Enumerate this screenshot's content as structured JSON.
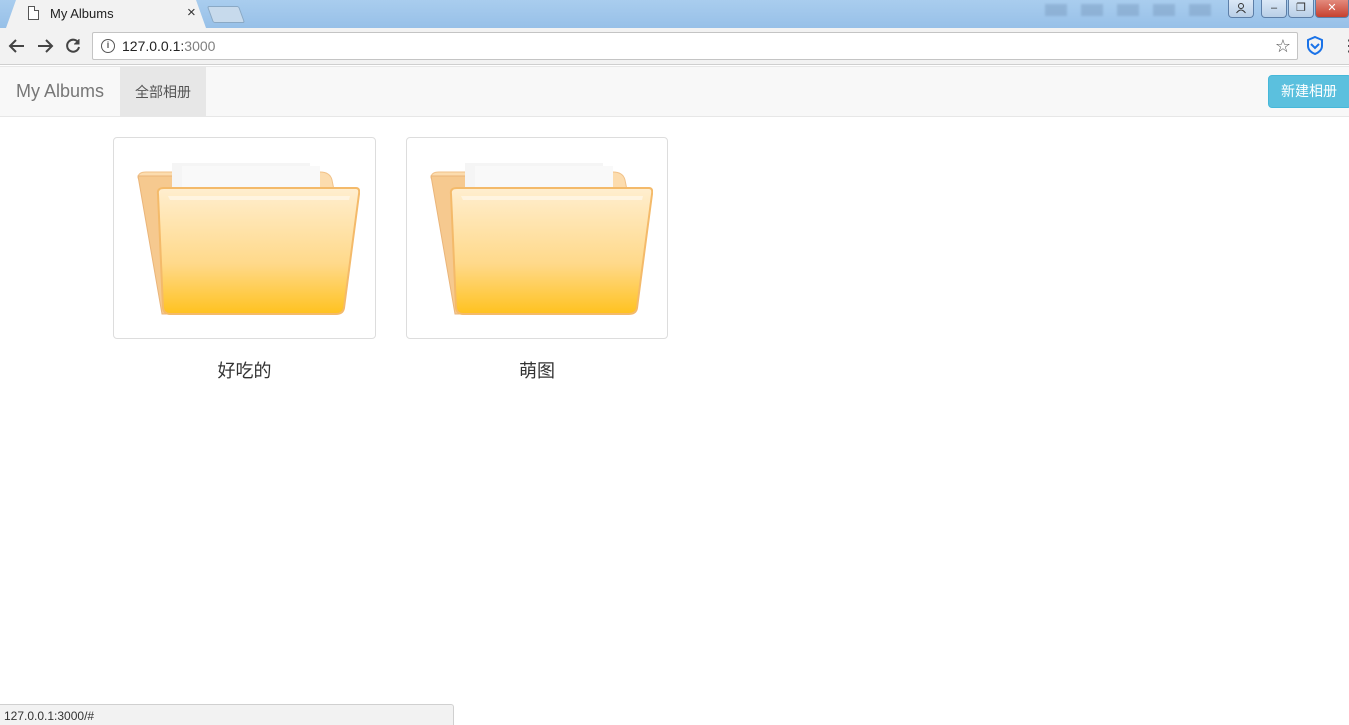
{
  "browser": {
    "tab_title": "My Albums",
    "tab_close": "×",
    "url_host": "127.0.0.1:",
    "url_port": "3000",
    "status_url": "127.0.0.1:3000/#"
  },
  "navbar": {
    "brand": "My Albums",
    "active_item": "全部相册",
    "new_album_button": "新建相册",
    "accent_color": "#5bc0de"
  },
  "albums": [
    {
      "name": "好吃的",
      "icon": "folder-icon"
    },
    {
      "name": "萌图",
      "icon": "folder-icon"
    }
  ]
}
